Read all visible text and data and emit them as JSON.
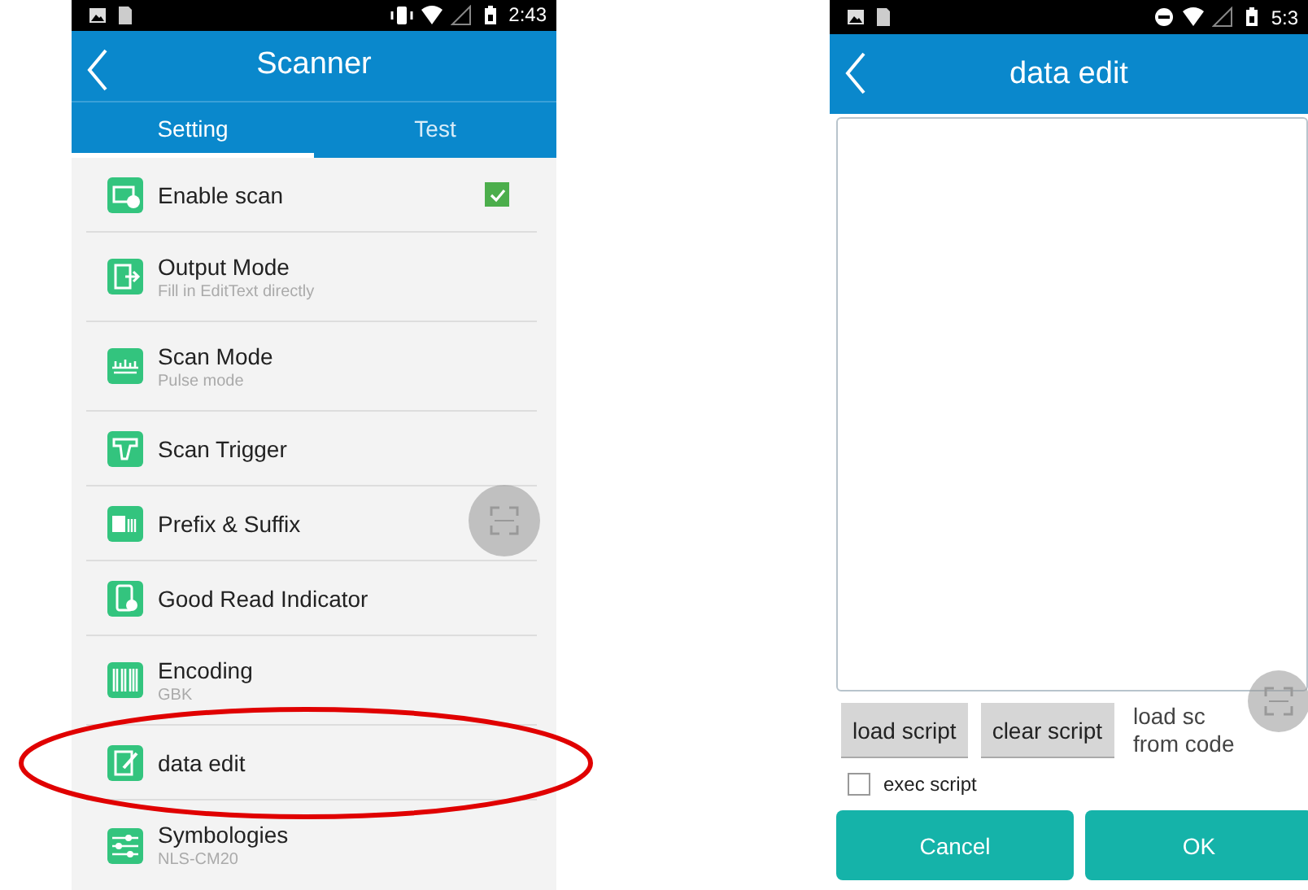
{
  "phones": [
    {
      "status_bar": {
        "time": "2:43"
      },
      "header": {
        "title": "Scanner"
      },
      "tabs": [
        {
          "label": "Setting",
          "selected": true
        },
        {
          "label": "Test",
          "selected": false
        }
      ],
      "settings": [
        {
          "kind": "checkbox",
          "title": "Enable scan",
          "checked": true,
          "highlighted": false
        },
        {
          "kind": "detail",
          "title": "Output Mode",
          "subtitle": "Fill in EditText directly",
          "highlighted": false
        },
        {
          "kind": "detail",
          "title": "Scan Mode",
          "subtitle": "Pulse mode",
          "highlighted": false
        },
        {
          "kind": "plain",
          "title": "Scan Trigger",
          "highlighted": false
        },
        {
          "kind": "plain",
          "title": "Prefix & Suffix",
          "highlighted": false
        },
        {
          "kind": "plain",
          "title": "Good Read Indicator",
          "highlighted": false
        },
        {
          "kind": "detail",
          "title": "Encoding",
          "subtitle": "GBK",
          "highlighted": false
        },
        {
          "kind": "plain",
          "title": "data edit",
          "highlighted": true
        },
        {
          "kind": "detail",
          "title": "Symbologies",
          "subtitle": "NLS-CM20",
          "highlighted": false
        }
      ]
    },
    {
      "status_bar": {
        "time": "5:3"
      },
      "header": {
        "title": "data edit"
      },
      "buttons": [
        "load script",
        "clear script"
      ],
      "note_lines": [
        "load sc",
        "from code"
      ],
      "exec_script": {
        "label": "exec script",
        "checked": false
      },
      "actions": [
        "Cancel",
        "OK"
      ]
    }
  ]
}
